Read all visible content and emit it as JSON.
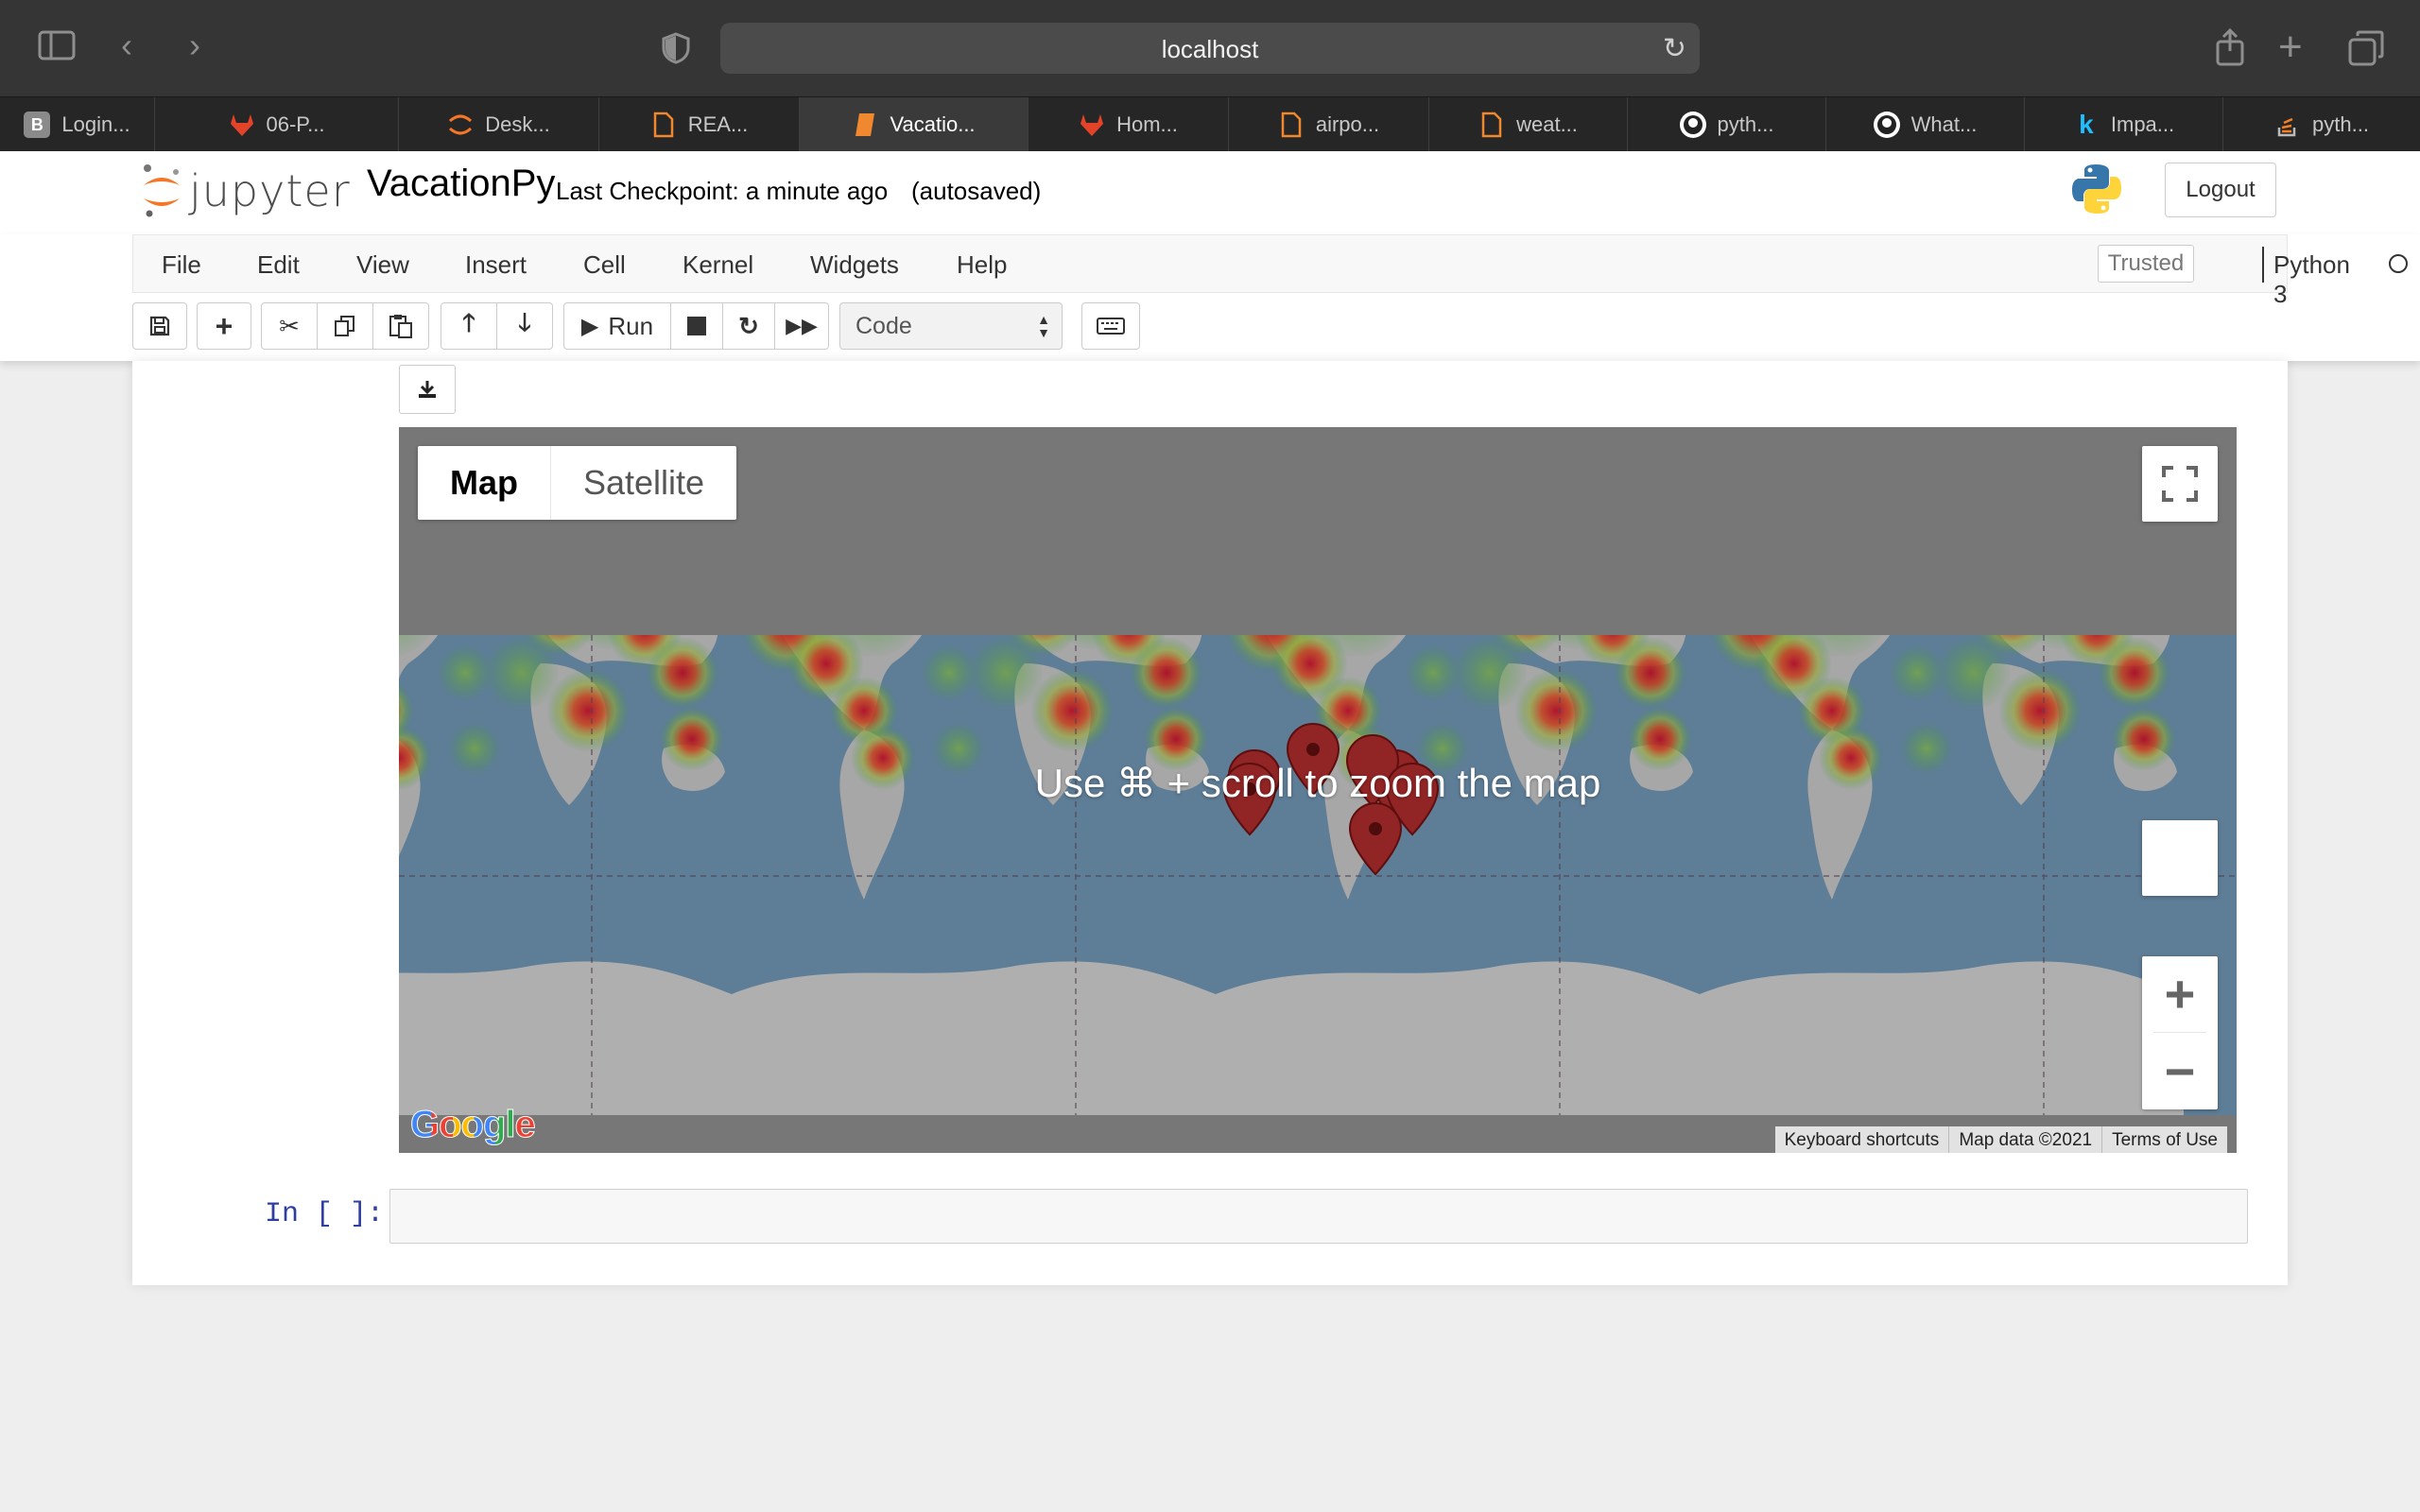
{
  "browser": {
    "url": "localhost",
    "tabs": [
      {
        "label": "Login...",
        "icon": "letter-b-icon",
        "active": false
      },
      {
        "label": "06-P...",
        "icon": "gitlab-icon",
        "active": false
      },
      {
        "label": "Desk...",
        "icon": "jupyter-icon",
        "active": false
      },
      {
        "label": "REA...",
        "icon": "file-icon",
        "active": false
      },
      {
        "label": "Vacatio...",
        "icon": "notebook-icon",
        "active": true
      },
      {
        "label": "Hom...",
        "icon": "gitlab-icon",
        "active": false
      },
      {
        "label": "airpo...",
        "icon": "file-icon",
        "active": false
      },
      {
        "label": "weat...",
        "icon": "file-icon",
        "active": false
      },
      {
        "label": "pyth...",
        "icon": "github-icon",
        "active": false
      },
      {
        "label": "What...",
        "icon": "github-icon",
        "active": false
      },
      {
        "label": "Impa...",
        "icon": "k-icon",
        "active": false
      },
      {
        "label": "pyth...",
        "icon": "stackoverflow-icon",
        "active": false
      }
    ]
  },
  "header": {
    "logo_text": "jupyter",
    "notebook_title": "VacationPy",
    "checkpoint": "Last Checkpoint: a minute ago",
    "autosave": "(autosaved)",
    "logout_label": "Logout"
  },
  "menubar": {
    "items": [
      "File",
      "Edit",
      "View",
      "Insert",
      "Cell",
      "Kernel",
      "Widgets",
      "Help"
    ],
    "trusted": "Trusted",
    "kernel": "Python 3"
  },
  "toolbar": {
    "run_label": "Run",
    "cell_type": "Code"
  },
  "map": {
    "type_buttons": [
      "Map",
      "Satellite"
    ],
    "zoom_hint": "Use ⌘ + scroll to zoom the map",
    "google_logo": "Google",
    "attribution": [
      "Keyboard shortcuts",
      "Map data ©2021",
      "Terms of Use"
    ],
    "zoom_in": "+",
    "zoom_out": "−",
    "colors": {
      "ocean": "#6b8fab",
      "land": "#c4c4c4",
      "frame": "#888888",
      "marker": "#a52a2a"
    }
  },
  "cell": {
    "prompt": "In [ ]:"
  }
}
